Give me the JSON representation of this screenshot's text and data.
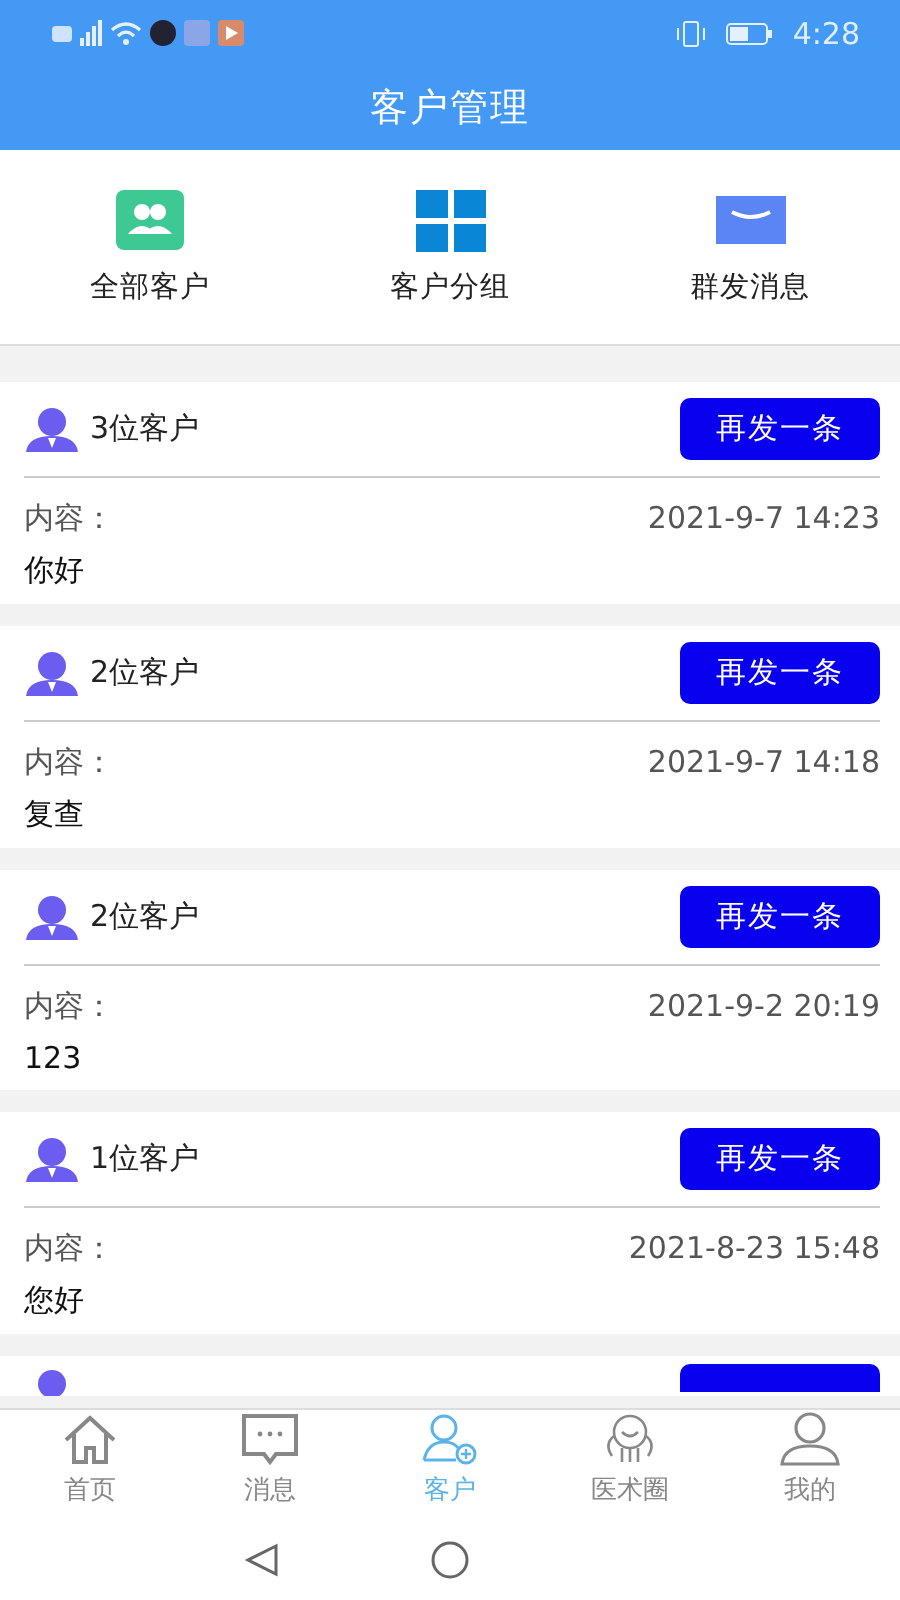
{
  "status_bar": {
    "time": "4:28"
  },
  "header": {
    "title": "客户管理"
  },
  "shortcuts": [
    {
      "label": "全部客户"
    },
    {
      "label": "客户分组"
    },
    {
      "label": "群发消息"
    }
  ],
  "messages": [
    {
      "kind": "full",
      "recipients": "3位客户",
      "button": "再发一条",
      "content_label": "内容：",
      "time": "2021-9-7 14:23",
      "content": "你好"
    },
    {
      "kind": "full",
      "recipients": "2位客户",
      "button": "再发一条",
      "content_label": "内容：",
      "time": "2021-9-7 14:18",
      "content": "复查"
    },
    {
      "kind": "full",
      "recipients": "2位客户",
      "button": "再发一条",
      "content_label": "内容：",
      "time": "2021-9-2 20:19",
      "content": "123"
    },
    {
      "kind": "full",
      "recipients": "1位客户",
      "button": "再发一条",
      "content_label": "内容：",
      "time": "2021-8-23 15:48",
      "content": "您好"
    },
    {
      "kind": "partial"
    }
  ],
  "tab_bar": [
    {
      "label": "首页",
      "selected": false
    },
    {
      "label": "消息",
      "selected": false
    },
    {
      "label": "客户",
      "selected": true
    },
    {
      "label": "医术圈",
      "selected": false
    },
    {
      "label": "我的",
      "selected": false
    }
  ]
}
